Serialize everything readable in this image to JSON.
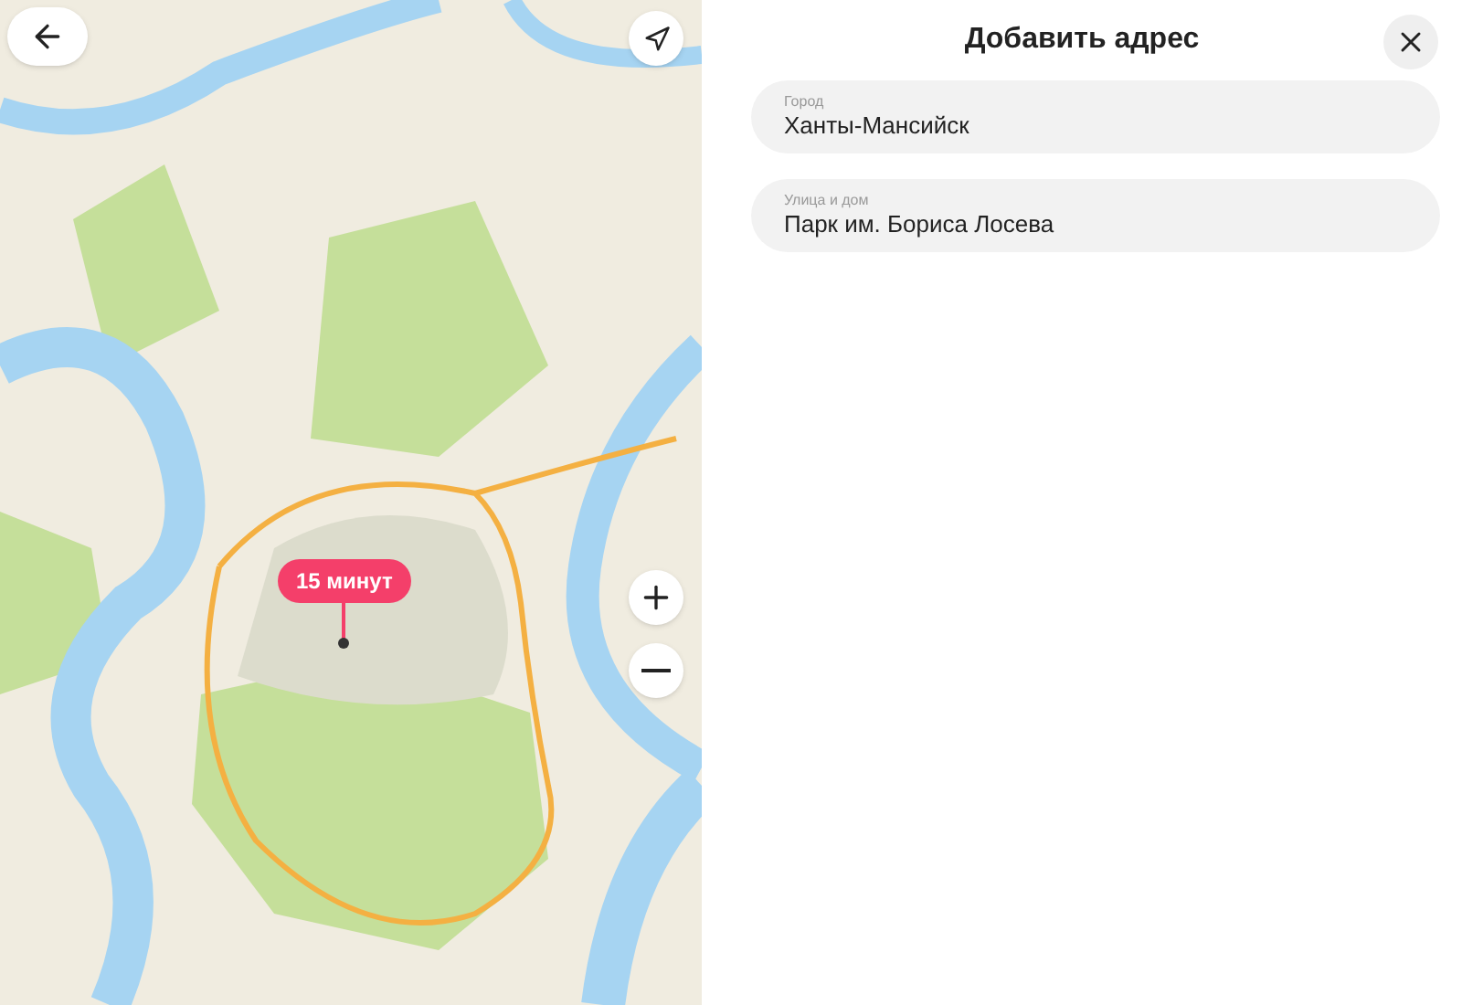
{
  "map": {
    "travel_badge": "15 минут"
  },
  "panel": {
    "title": "Добавить адрес",
    "fields": [
      {
        "label": "Город",
        "value": "Ханты-Мансийск"
      },
      {
        "label": "Улица и дом",
        "value": "Парк им. Бориса Лосева"
      }
    ]
  }
}
